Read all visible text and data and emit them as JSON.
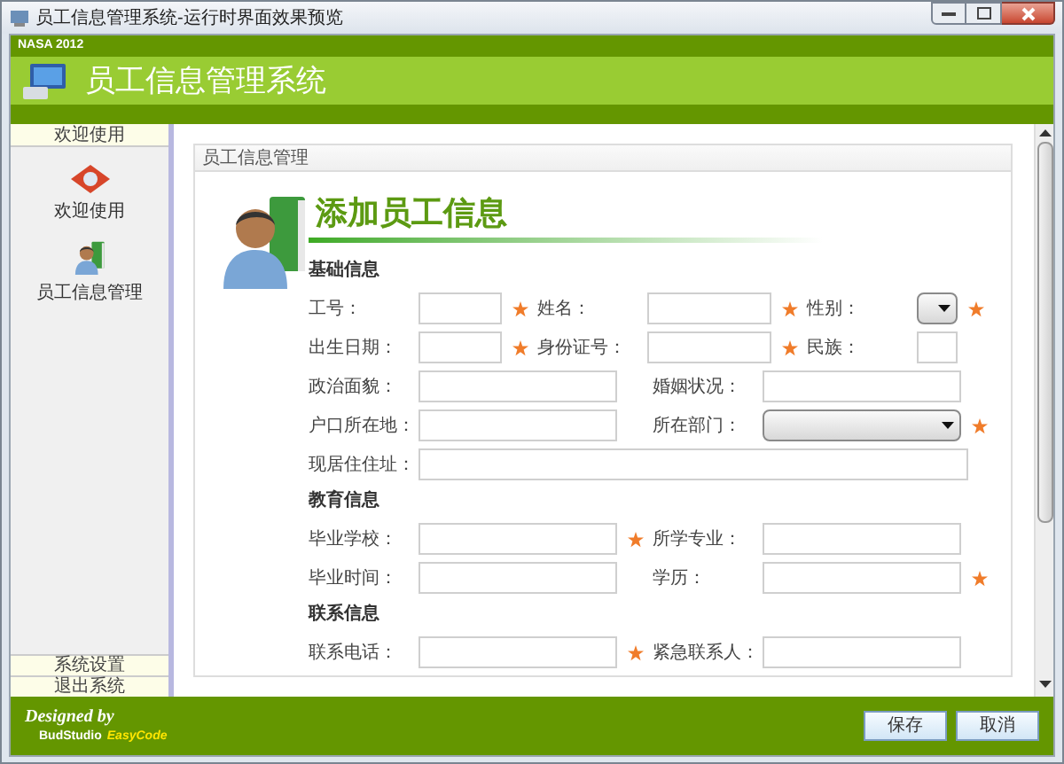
{
  "window": {
    "title": "员工信息管理系统-运行时界面效果预览"
  },
  "header": {
    "brand": "NASA 2012",
    "title": "员工信息管理系统"
  },
  "sidebar": {
    "header": "欢迎使用",
    "items": [
      {
        "label": "欢迎使用",
        "kind": "welcome"
      },
      {
        "label": "员工信息管理",
        "kind": "staff"
      }
    ],
    "footer_items": [
      "系统设置",
      "退出系统"
    ]
  },
  "panel": {
    "title": "员工信息管理",
    "heading": "添加员工信息",
    "sections": [
      {
        "title": "基础信息",
        "rows": [
          [
            {
              "label": "工号：",
              "kind": "text",
              "required": true
            },
            {
              "label": "姓名：",
              "kind": "text",
              "required": true
            },
            {
              "label": "性别：",
              "kind": "select",
              "required": true
            }
          ],
          [
            {
              "label": "出生日期：",
              "kind": "text",
              "required": true
            },
            {
              "label": "身份证号：",
              "kind": "text",
              "required": true
            },
            {
              "label": "民族：",
              "kind": "text",
              "required": false
            }
          ],
          [
            {
              "label": "政治面貌：",
              "kind": "text",
              "required": false
            },
            {
              "label": "婚姻状况：",
              "kind": "text",
              "required": false
            }
          ],
          [
            {
              "label": "户口所在地：",
              "kind": "text",
              "required": false
            },
            {
              "label": "所在部门：",
              "kind": "select",
              "required": true
            }
          ],
          [
            {
              "label": "现居住住址：",
              "kind": "text",
              "required": false
            }
          ]
        ]
      },
      {
        "title": "教育信息",
        "rows": [
          [
            {
              "label": "毕业学校：",
              "kind": "text",
              "required": true
            },
            {
              "label": "所学专业：",
              "kind": "text",
              "required": false
            }
          ],
          [
            {
              "label": "毕业时间：",
              "kind": "text",
              "required": false
            },
            {
              "label": "学历：",
              "kind": "text",
              "required": true
            }
          ]
        ]
      },
      {
        "title": "联系信息",
        "rows": [
          [
            {
              "label": "联系电话：",
              "kind": "text",
              "required": true
            },
            {
              "label": "紧急联系人：",
              "kind": "text",
              "required": false
            }
          ]
        ]
      }
    ]
  },
  "footer": {
    "credit": "Designed by",
    "studio": "BudStudio",
    "product": "EasyCode",
    "buttons": [
      "保存",
      "取消"
    ]
  }
}
